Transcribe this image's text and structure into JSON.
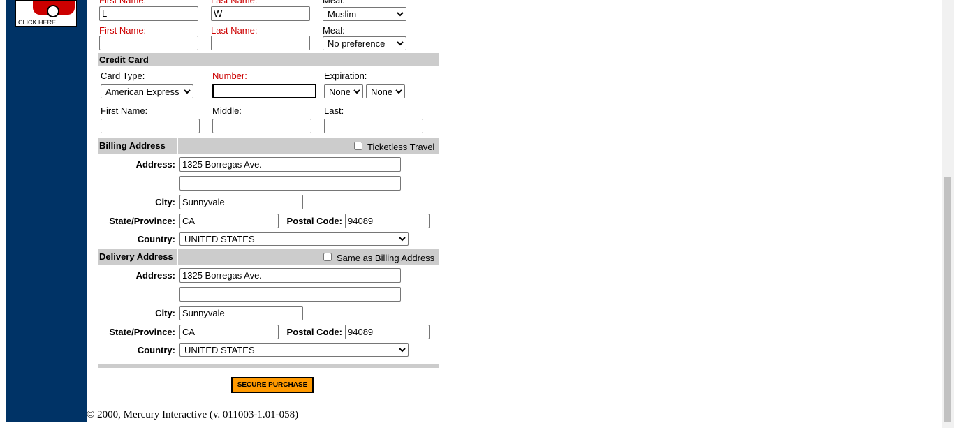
{
  "ad": {
    "text": "CLICK HERE"
  },
  "passenger1": {
    "first_label": "First Name:",
    "last_label": "Last Name:",
    "meal_label": "Meal:",
    "first_value": "L",
    "last_value": "W",
    "meal_value": "Muslim"
  },
  "passenger2": {
    "first_label": "First Name:",
    "last_label": "Last Name:",
    "meal_label": "Meal:",
    "first_value": "",
    "last_value": "",
    "meal_value": "No preference"
  },
  "credit_card": {
    "title": "Credit Card",
    "type_label": "Card Type:",
    "type_value": "American Express",
    "number_label": "Number:",
    "number_value": "",
    "expiration_label": "Expiration:",
    "exp_month": "None",
    "exp_year": "None",
    "first_label": "First Name:",
    "middle_label": "Middle:",
    "last_label": "Last:"
  },
  "billing": {
    "title": "Billing Address",
    "ticketless_label": "Ticketless Travel",
    "address_label": "Address:",
    "address1": "1325 Borregas Ave.",
    "address2": "",
    "city_label": "City:",
    "city": "Sunnyvale",
    "state_label": "State/Province:",
    "state": "CA",
    "postal_label": "Postal Code:",
    "postal": "94089",
    "country_label": "Country:",
    "country": "UNITED STATES"
  },
  "delivery": {
    "title": "Delivery Address",
    "same_label": "Same as Billing Address",
    "address_label": "Address:",
    "address1": "1325 Borregas Ave.",
    "address2": "",
    "city_label": "City:",
    "city": "Sunnyvale",
    "state_label": "State/Province:",
    "state": "CA",
    "postal_label": "Postal Code:",
    "postal": "94089",
    "country_label": "Country:",
    "country": "UNITED STATES"
  },
  "submit_label": "SECURE PURCHASE",
  "footer": "© 2000, Mercury Interactive (v. 011003-1.01-058)"
}
